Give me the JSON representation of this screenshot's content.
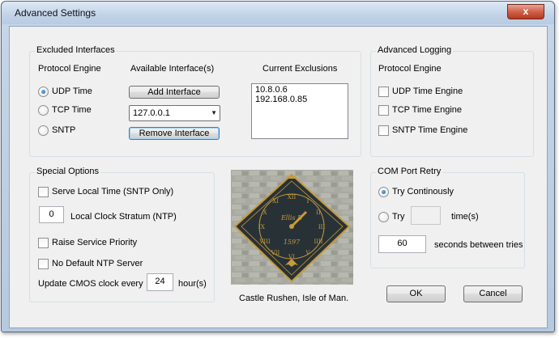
{
  "window": {
    "title": "Advanced Settings",
    "close_label": "x"
  },
  "excluded": {
    "legend": "Excluded Interfaces",
    "protocol_header": "Protocol Engine",
    "available_header": "Available Interface(s)",
    "exclusions_header": "Current Exclusions",
    "radios": [
      {
        "label": "UDP Time",
        "selected": true
      },
      {
        "label": "TCP Time",
        "selected": false
      },
      {
        "label": "SNTP",
        "selected": false
      }
    ],
    "add_button": "Add Interface",
    "interface_select": "127.0.0.1",
    "remove_button": "Remove Interface",
    "exclusions": [
      "10.8.0.6",
      "192.168.0.85"
    ]
  },
  "logging": {
    "legend": "Advanced Logging",
    "protocol_header": "Protocol Engine",
    "checks": [
      {
        "label": "UDP Time Engine",
        "checked": false
      },
      {
        "label": "TCP Time Engine",
        "checked": false
      },
      {
        "label": "SNTP Time Engine",
        "checked": false
      }
    ]
  },
  "special": {
    "legend": "Special Options",
    "serve_local": "Serve Local Time (SNTP Only)",
    "stratum_value": "0",
    "stratum_label": "Local Clock Stratum (NTP)",
    "raise_priority": "Raise Service Priority",
    "no_default_ntp": "No Default NTP Server",
    "cmos_prefix": "Update CMOS clock every",
    "cmos_value": "24",
    "cmos_suffix": "hour(s)"
  },
  "photo": {
    "caption": "Castle Rushen, Isle of Man.",
    "clock_text": "Ellis B",
    "clock_year": "1597"
  },
  "com": {
    "legend": "COM Port Retry",
    "try_continuously": "Try Continously",
    "try_label": "Try",
    "try_value": "",
    "times_label": "time(s)",
    "seconds_value": "60",
    "seconds_label": "seconds between tries"
  },
  "buttons": {
    "ok": "OK",
    "cancel": "Cancel"
  },
  "colors": {
    "frame": "#b9cbe1",
    "client": "#f0f0f0",
    "clock_face": "#1f2a2e",
    "clock_gold": "#c79a3c",
    "stone": "#a8a9a0"
  }
}
